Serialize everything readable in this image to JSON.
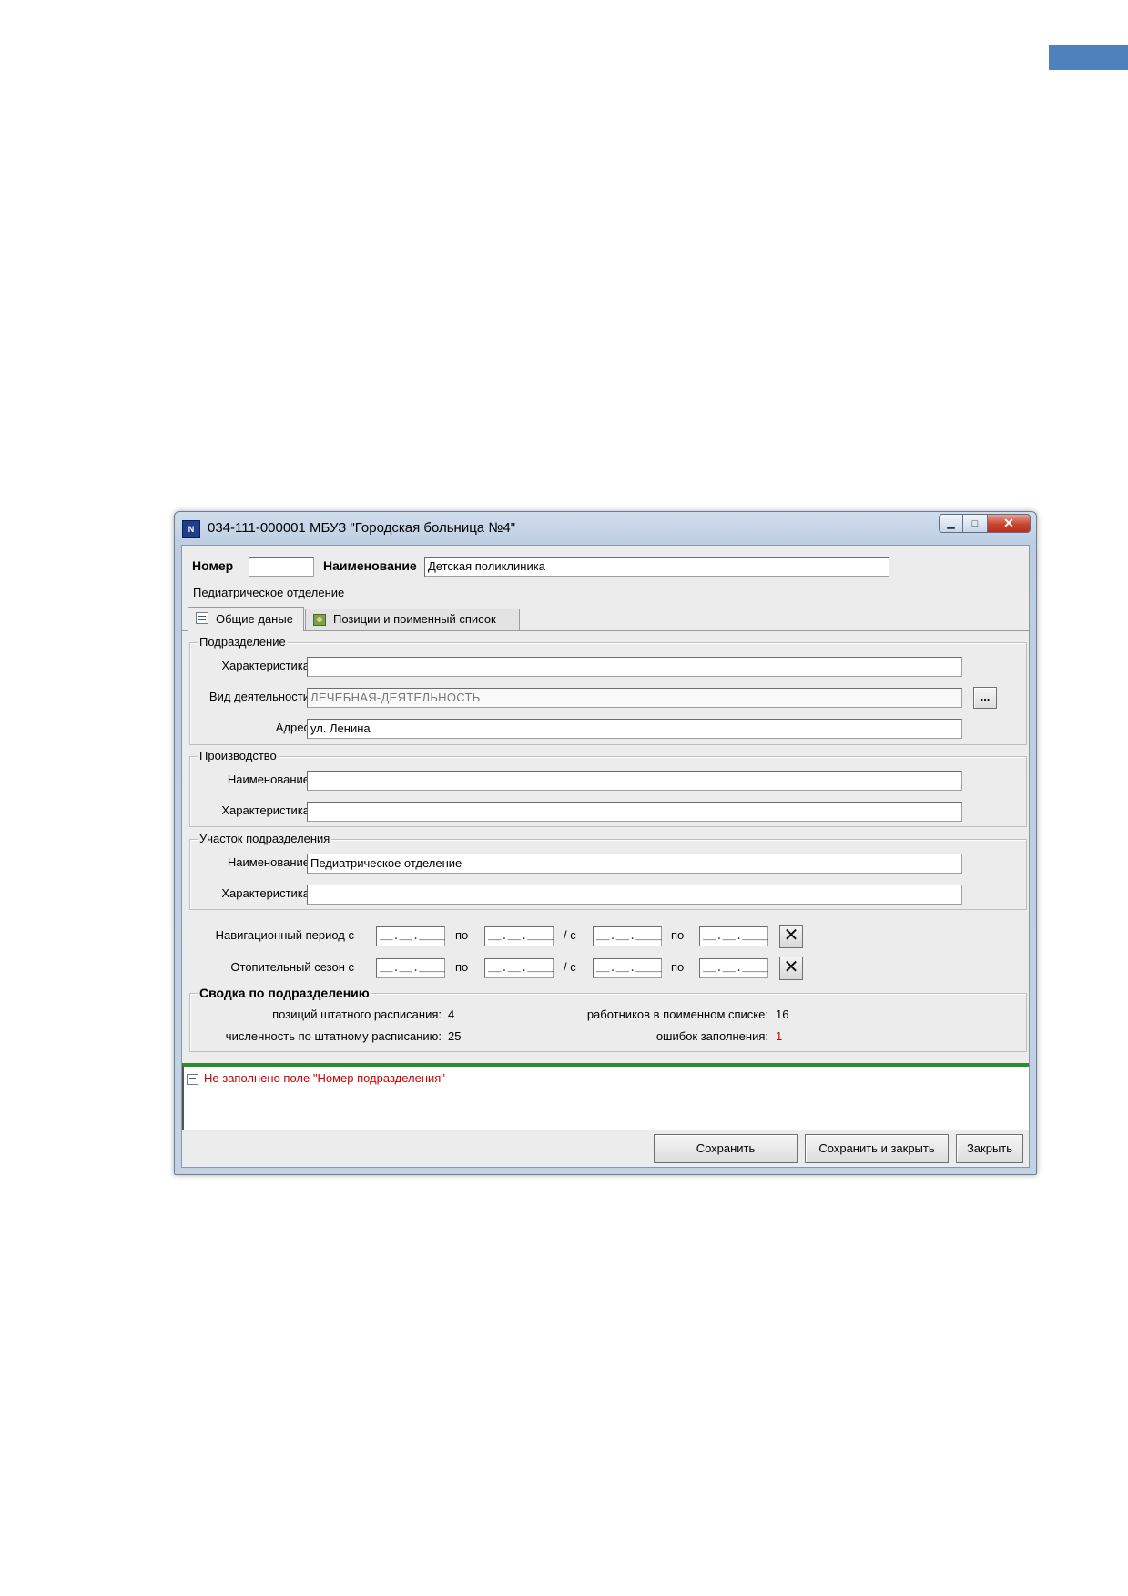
{
  "window": {
    "title": "034-111-000001 МБУЗ  \"Городская больница №4\"",
    "icon_text": "N",
    "minimize_glyph": "▁",
    "maximize_glyph": "□",
    "close_glyph": "✕"
  },
  "header": {
    "number_label": "Номер",
    "number_value": "",
    "name_label": "Наименование",
    "name_value": "Детская поликлиника",
    "subtitle": "Педиатрическое отделение"
  },
  "tabs": [
    {
      "label": "Общие даные",
      "active": true
    },
    {
      "label": "Позиции и поименный список",
      "active": false
    }
  ],
  "subdivision": {
    "title": "Подразделение",
    "characteristic_label": "Характеристика",
    "characteristic_value": "",
    "activity_label": "Вид деятельности",
    "activity_value": "ЛЕЧЕБНАЯ-ДЕЯТЕЛЬНОСТЬ",
    "browse_label": "...",
    "address_label": "Адрес",
    "address_value": "ул. Ленина"
  },
  "production": {
    "title": "Производство",
    "name_label": "Наименование",
    "name_value": "",
    "characteristic_label": "Характеристика",
    "characteristic_value": ""
  },
  "section": {
    "title": "Участок подразделения",
    "name_label": "Наименование",
    "name_value": "Педиатрическое отделение",
    "characteristic_label": "Характеристика",
    "characteristic_value": ""
  },
  "periods": {
    "nav_label": "Навигационный период с",
    "heat_label": "Отопительный сезон с",
    "to_label": "по",
    "slash_from_label": "/ с",
    "date_mask": "__.__.____",
    "clear_glyph": "✕"
  },
  "summary": {
    "title": "Сводка по подразделению",
    "positions_label": "позиций штатного расписания:",
    "positions_value": "4",
    "headcount_label": "численность по штатному расписанию:",
    "headcount_value": "25",
    "workers_label": "работников в поименном списке:",
    "workers_value": "16",
    "errors_label": "ошибок заполнения:",
    "errors_value": "1"
  },
  "messages": {
    "error_text": "Не заполнено поле \"Номер подразделения\""
  },
  "buttons": {
    "save": "Сохранить",
    "save_close": "Сохранить и закрыть",
    "close": "Закрыть"
  }
}
